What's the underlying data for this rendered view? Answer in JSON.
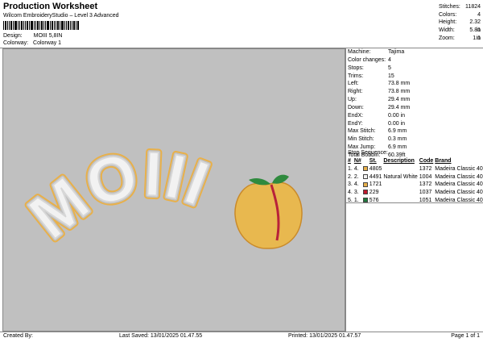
{
  "header": {
    "title": "Production Worksheet",
    "subtitle": "Wilcom EmbroideryStudio – Level 3 Advanced",
    "design_label": "Design:",
    "design_value": "MOIII 5,8IN",
    "colorway_label": "Colorway:",
    "colorway_value": "Colorway 1"
  },
  "stats": {
    "stitches_label": "Stitches:",
    "stitches": "11824",
    "colors_label": "Colors:",
    "colors": "4",
    "height_label": "Height:",
    "height": "2.32 in",
    "width_label": "Width:",
    "width": "5.81 in",
    "zoom_label": "Zoom:",
    "zoom": "1:1"
  },
  "design": {
    "text": "MOIII",
    "fill_color": "#f2f2f2",
    "outline_color": "#e8b04a",
    "inner_outline_color": "#d7d7d7",
    "peach_color": "#e8b84f",
    "peach_stroke": "#c98a2a",
    "leaf_color": "#2f8a3e",
    "stem_color": "#b8223a",
    "canvas_bg": "#c0c0c0"
  },
  "details": [
    {
      "label": "Machine:",
      "value": "Tajima"
    },
    {
      "label": "Color changes:",
      "value": "4"
    },
    {
      "label": "Stops:",
      "value": "5"
    },
    {
      "label": "Trims:",
      "value": "15"
    },
    {
      "label": "Left:",
      "value": "73.8 mm"
    },
    {
      "label": "Right:",
      "value": "73.8 mm"
    },
    {
      "label": "Up:",
      "value": "29.4 mm"
    },
    {
      "label": "Down:",
      "value": "29.4 mm"
    },
    {
      "label": "EndX:",
      "value": "0.00 in"
    },
    {
      "label": "EndY:",
      "value": "0.00 in"
    },
    {
      "label": "Max Stitch:",
      "value": "6.9 mm"
    },
    {
      "label": "Min Stitch:",
      "value": "0.3 mm"
    },
    {
      "label": "Max Jump:",
      "value": "6.9 mm"
    },
    {
      "label": "Total Bobbin:",
      "value": "60.39ft"
    }
  ],
  "sequence": {
    "title": "Stop Sequence:",
    "headers": [
      "#",
      "N#",
      "St.",
      "Description",
      "Code",
      "Brand"
    ],
    "rows": [
      {
        "idx": "1.",
        "n": "4.",
        "swatch": "#e8b04a",
        "st": "4805",
        "desc": "",
        "code": "1372",
        "brand": "Madeira Classic 40"
      },
      {
        "idx": "2.",
        "n": "2.",
        "swatch": "#f2f2f2",
        "st": "4491",
        "desc": "Natural White",
        "code": "1004",
        "brand": "Madeira Classic 40"
      },
      {
        "idx": "3.",
        "n": "4.",
        "swatch": "#e8b04a",
        "st": "1721",
        "desc": "",
        "code": "1372",
        "brand": "Madeira Classic 40"
      },
      {
        "idx": "4.",
        "n": "3.",
        "swatch": "#c0182e",
        "st": "229",
        "desc": "",
        "code": "1037",
        "brand": "Madeira Classic 40"
      },
      {
        "idx": "5.",
        "n": "1.",
        "swatch": "#1e7a3c",
        "st": "576",
        "desc": "",
        "code": "1051",
        "brand": "Madeira Classic 40"
      }
    ]
  },
  "footer": {
    "created": "Created By:",
    "last_saved": "Last Saved: 13/01/2025 01.47.55",
    "printed": "Printed: 13/01/2025 01.47.57",
    "page": "Page 1 of 1"
  }
}
